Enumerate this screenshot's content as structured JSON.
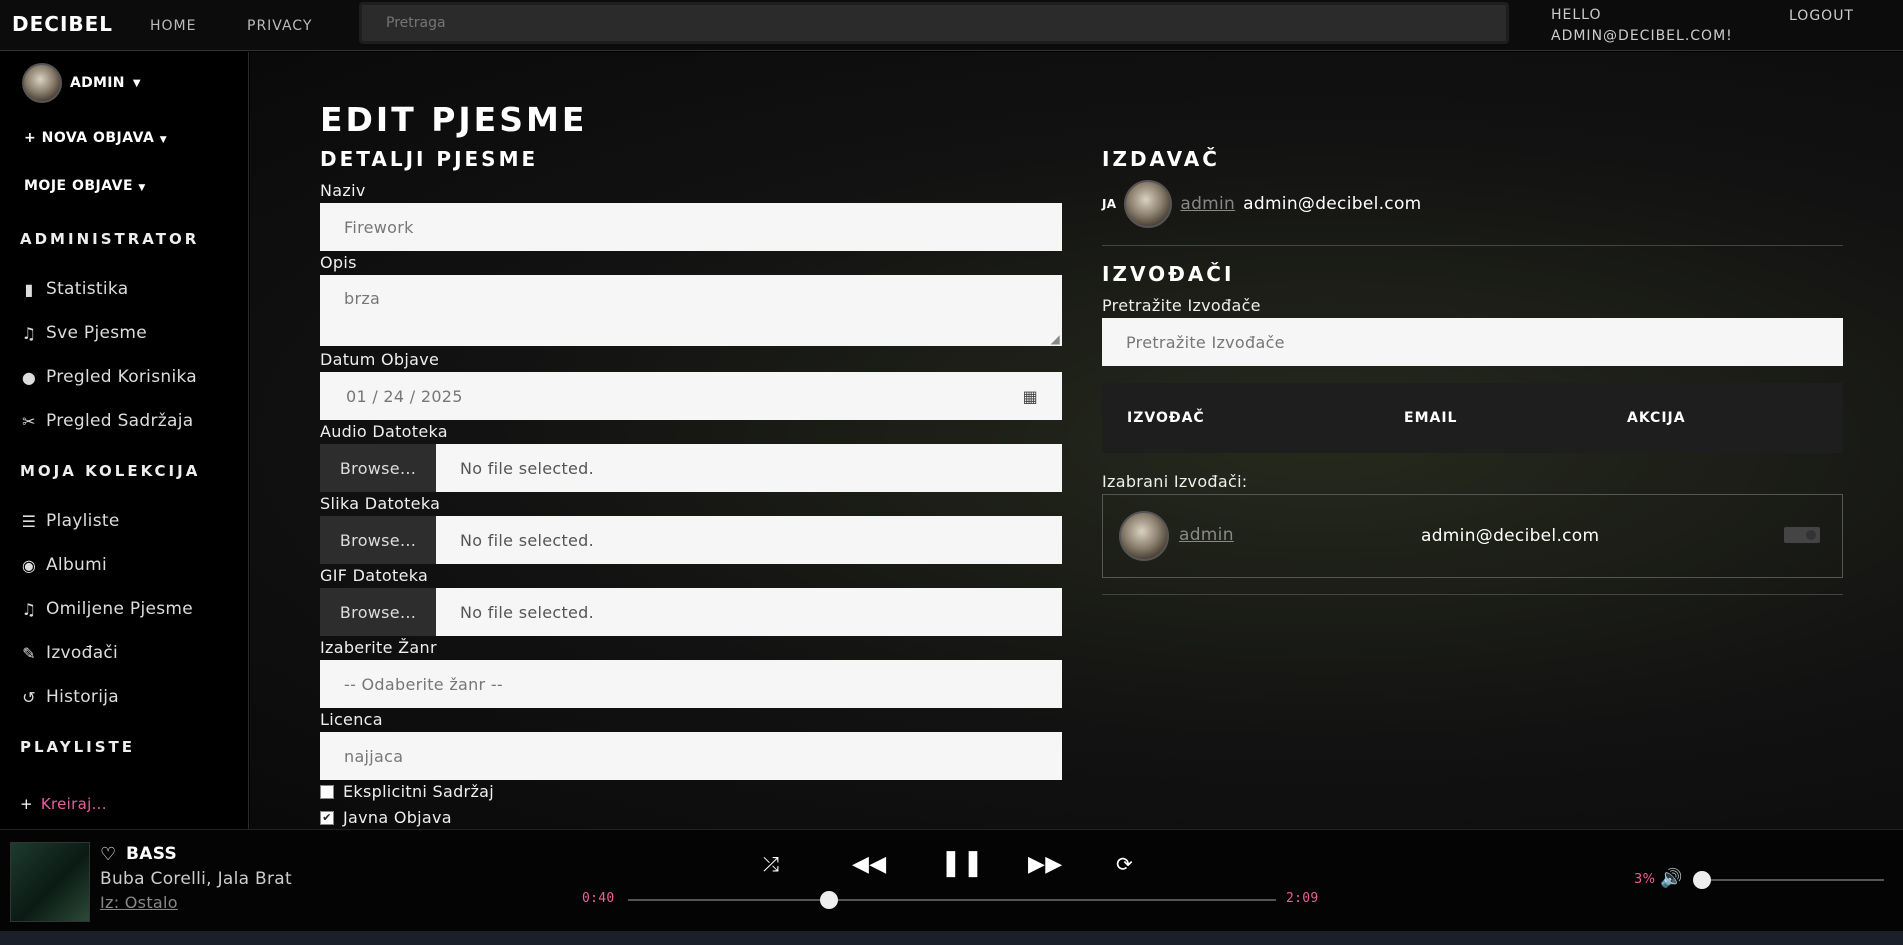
{
  "nav": {
    "brand": "DECIBEL",
    "home": "HOME",
    "privacy": "PRIVACY",
    "search_placeholder": "Pretraga",
    "hello": "HELLO",
    "user_email": "ADMIN@DECIBEL.COM!",
    "logout": "LOGOUT"
  },
  "sidebar": {
    "user": "ADMIN",
    "new_post": "NOVA OBJAVA",
    "my_posts": "MOJE OBJAVE",
    "admin_head": "ADMINISTRATOR",
    "admin_items": [
      {
        "label": "Statistika",
        "icon": "bar-chart-icon"
      },
      {
        "label": "Sve Pjesme",
        "icon": "music-note-icon"
      },
      {
        "label": "Pregled Korisnika",
        "icon": "user-icon"
      },
      {
        "label": "Pregled Sadržaja",
        "icon": "tools-icon"
      }
    ],
    "collection_head": "MOJA KOLEKCIJA",
    "collection_items": [
      {
        "label": "Playliste",
        "icon": "list-icon"
      },
      {
        "label": "Albumi",
        "icon": "disc-icon"
      },
      {
        "label": "Omiljene Pjesme",
        "icon": "music-note-icon"
      },
      {
        "label": "Izvođači",
        "icon": "microphone-icon"
      },
      {
        "label": "Historija",
        "icon": "history-icon"
      }
    ],
    "playlists_head": "PLAYLISTE",
    "create": "Kreiraj..."
  },
  "form": {
    "page_title": "EDIT PJESME",
    "section": "DETALJI PJESME",
    "naziv_label": "Naziv",
    "naziv_value": "Firework",
    "opis_label": "Opis",
    "opis_value": "brza",
    "datum_label": "Datum Objave",
    "datum_value": "01 / 24 / 2025",
    "audio_label": "Audio Datoteka",
    "slika_label": "Slika Datoteka",
    "gif_label": "GIF Datoteka",
    "browse": "Browse...",
    "no_file": "No file selected.",
    "zanr_label": "Izaberite Žanr",
    "zanr_value": "-- Odaberite žanr --",
    "licenca_label": "Licenca",
    "licenca_value": "najjaca",
    "explicit_label": "Eksplicitni Sadržaj",
    "explicit_checked": false,
    "public_label": "Javna Objava",
    "public_checked": true
  },
  "publisher": {
    "head": "IZDAVAČ",
    "ja": "JA",
    "name": "admin",
    "email": "admin@decibel.com"
  },
  "artists": {
    "head": "IZVOĐAČI",
    "search_label": "Pretražite Izvođače",
    "search_placeholder": "Pretražite Izvođače",
    "columns": [
      "IZVOĐAČ",
      "EMAIL",
      "AKCIJA"
    ],
    "selected_label": "Izabrani Izvođači:",
    "selected": [
      {
        "name": "admin",
        "email": "admin@decibel.com"
      }
    ]
  },
  "player": {
    "title": "BASS",
    "artist": "Buba Corelli, Jala Brat",
    "source": "Iz: Ostalo",
    "elapsed": "0:40",
    "duration": "2:09",
    "progress": 0.31,
    "volume_label": "3%",
    "volume": 0.03,
    "accent": "#e8609a"
  }
}
